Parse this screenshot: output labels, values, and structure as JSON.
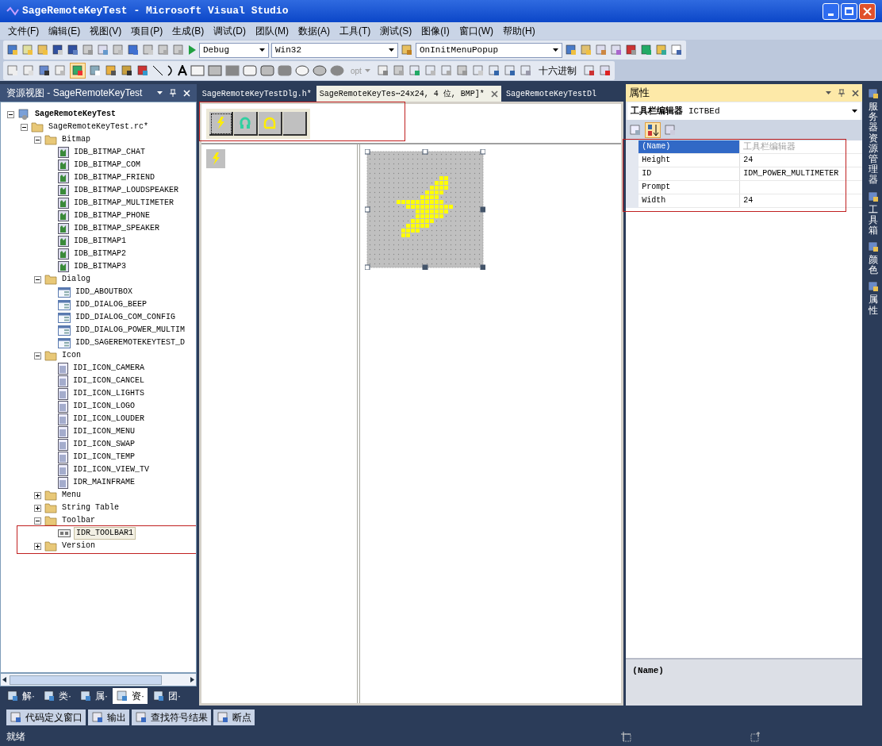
{
  "window": {
    "title": "SageRemoteKeyTest - Microsoft Visual Studio"
  },
  "menu": [
    "文件(F)",
    "编辑(E)",
    "视图(V)",
    "项目(P)",
    "生成(B)",
    "调试(D)",
    "团队(M)",
    "数据(A)",
    "工具(T)",
    "测试(S)",
    "图像(I)",
    "窗口(W)",
    "帮助(H)"
  ],
  "toolbar": {
    "configuration": "Debug",
    "platform": "Win32",
    "function": "OnInitMenuPopup",
    "opt_label": "opt",
    "hex_button": "十六进制"
  },
  "resource_view": {
    "title": "资源视图 - SageRemoteKeyTest",
    "tree": [
      {
        "label": "SageRemoteKeyTest",
        "kind": "project",
        "expanded": true,
        "selected": false,
        "children": [
          {
            "label": "SageRemoteKeyTest.rc*",
            "kind": "folder",
            "expanded": true,
            "selected": false,
            "children": [
              {
                "label": "Bitmap",
                "kind": "folder",
                "expanded": true,
                "selected": false,
                "children": [
                  {
                    "label": "IDB_BITMAP_CHAT",
                    "kind": "bitmap",
                    "selected": false
                  },
                  {
                    "label": "IDB_BITMAP_COM",
                    "kind": "bitmap",
                    "selected": false
                  },
                  {
                    "label": "IDB_BITMAP_FRIEND",
                    "kind": "bitmap",
                    "selected": false
                  },
                  {
                    "label": "IDB_BITMAP_LOUDSPEAKER",
                    "kind": "bitmap",
                    "selected": false
                  },
                  {
                    "label": "IDB_BITMAP_MULTIMETER",
                    "kind": "bitmap",
                    "selected": false
                  },
                  {
                    "label": "IDB_BITMAP_PHONE",
                    "kind": "bitmap",
                    "selected": false
                  },
                  {
                    "label": "IDB_BITMAP_SPEAKER",
                    "kind": "bitmap",
                    "selected": false
                  },
                  {
                    "label": "IDB_BITMAP1",
                    "kind": "bitmap",
                    "selected": false
                  },
                  {
                    "label": "IDB_BITMAP2",
                    "kind": "bitmap",
                    "selected": false
                  },
                  {
                    "label": "IDB_BITMAP3",
                    "kind": "bitmap",
                    "selected": false
                  }
                ]
              },
              {
                "label": "Dialog",
                "kind": "folder",
                "expanded": true,
                "selected": false,
                "children": [
                  {
                    "label": "IDD_ABOUTBOX",
                    "kind": "dialog",
                    "selected": false
                  },
                  {
                    "label": "IDD_DIALOG_BEEP",
                    "kind": "dialog",
                    "selected": false
                  },
                  {
                    "label": "IDD_DIALOG_COM_CONFIG",
                    "kind": "dialog",
                    "selected": false
                  },
                  {
                    "label": "IDD_DIALOG_POWER_MULTIM",
                    "kind": "dialog",
                    "selected": false
                  },
                  {
                    "label": "IDD_SAGEREMOTEKEYTEST_D",
                    "kind": "dialog",
                    "selected": false
                  }
                ]
              },
              {
                "label": "Icon",
                "kind": "folder",
                "expanded": true,
                "selected": false,
                "children": [
                  {
                    "label": "IDI_ICON_CAMERA",
                    "kind": "icon",
                    "selected": false
                  },
                  {
                    "label": "IDI_ICON_CANCEL",
                    "kind": "icon",
                    "selected": false
                  },
                  {
                    "label": "IDI_ICON_LIGHTS",
                    "kind": "icon",
                    "selected": false
                  },
                  {
                    "label": "IDI_ICON_LOGO",
                    "kind": "icon",
                    "selected": false
                  },
                  {
                    "label": "IDI_ICON_LOUDER",
                    "kind": "icon",
                    "selected": false
                  },
                  {
                    "label": "IDI_ICON_MENU",
                    "kind": "icon",
                    "selected": false
                  },
                  {
                    "label": "IDI_ICON_SWAP",
                    "kind": "icon",
                    "selected": false
                  },
                  {
                    "label": "IDI_ICON_TEMP",
                    "kind": "icon",
                    "selected": false
                  },
                  {
                    "label": "IDI_ICON_VIEW_TV",
                    "kind": "icon",
                    "selected": false
                  },
                  {
                    "label": "IDR_MAINFRAME",
                    "kind": "icon",
                    "selected": false
                  }
                ]
              },
              {
                "label": "Menu",
                "kind": "folder",
                "expanded": false,
                "selected": false
              },
              {
                "label": "String Table",
                "kind": "folder",
                "expanded": false,
                "selected": false
              },
              {
                "label": "Toolbar",
                "kind": "folder",
                "expanded": true,
                "selected": false,
                "children": [
                  {
                    "label": "IDR_TOOLBAR1",
                    "kind": "toolbar",
                    "selected": true
                  }
                ]
              },
              {
                "label": "Version",
                "kind": "folder",
                "expanded": false,
                "selected": false
              }
            ]
          }
        ]
      }
    ],
    "tabs": [
      {
        "label": "解·",
        "selected": false
      },
      {
        "label": "类·",
        "selected": false
      },
      {
        "label": "属·",
        "selected": false
      },
      {
        "label": "资·",
        "selected": true
      },
      {
        "label": "团·",
        "selected": false
      }
    ]
  },
  "editor": {
    "tabs": [
      {
        "label": "SageRemoteKeyTestDlg.h*",
        "selected": false,
        "closable": false
      },
      {
        "label": "SageRemoteKeyTes⋯24x24, 4 位, BMP]*",
        "selected": true,
        "closable": true
      },
      {
        "label": "SageRemoteKeyTestDl",
        "selected": false,
        "closable": false
      }
    ],
    "toolbar_buttons": [
      {
        "kind": "bolt",
        "selected": true
      },
      {
        "kind": "headset",
        "selected": false
      },
      {
        "kind": "arch",
        "selected": false
      },
      {
        "kind": "blank",
        "selected": false
      }
    ]
  },
  "properties": {
    "title": "属性",
    "object": "**工具栏编辑器** ICTBEd",
    "rows": [
      {
        "name": "(Name)",
        "value": "工具栏编辑器",
        "selected": true,
        "readonly": true
      },
      {
        "name": "Height",
        "value": "24",
        "selected": false
      },
      {
        "name": "ID",
        "value": "IDM_POWER_MULTIMETER",
        "selected": false
      },
      {
        "name": "Prompt",
        "selected": false
      },
      {
        "name": "Width",
        "value": "24",
        "selected": false
      }
    ],
    "description": "(Name)"
  },
  "side_tabs": [
    "服务器资源管理器",
    "工具箱",
    "颜色",
    "属性"
  ],
  "output_tabs": [
    "代码定义窗口",
    "输出",
    "查找符号结果",
    "断点"
  ],
  "status": "就绪"
}
